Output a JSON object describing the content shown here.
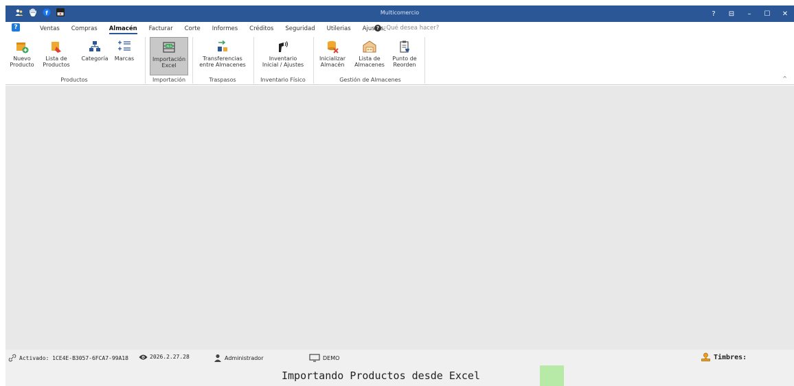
{
  "window": {
    "title": "Multicomercio",
    "controls": [
      "?",
      "⊟",
      "–",
      "☐",
      "✕"
    ],
    "quick_access_icons": [
      "users-icon",
      "hand-icon",
      "facebook-icon",
      "youtube-icon"
    ]
  },
  "menu": {
    "help_label": "?",
    "tabs": [
      "Ventas",
      "Compras",
      "Almacén",
      "Facturar",
      "Corte",
      "Informes",
      "Créditos",
      "Seguridad",
      "Utilerias",
      "Ajustes"
    ],
    "active_tab": "Almacén",
    "search_placeholder": "¿Qué desea hacer?"
  },
  "ribbon": {
    "groups": {
      "productos": "Productos",
      "importacion": "Importación",
      "traspasos": "Traspasos",
      "inventario": "Inventario Físico",
      "gestion": "Gestión de Almacenes"
    },
    "buttons": {
      "nuevo_producto": "Nuevo\nProducto",
      "lista_productos": "Lista de\nProductos",
      "categoria": "Categoría",
      "marcas": "Marcas",
      "importacion_excel": "Importación\nExcel",
      "transferencias": "Transferencias\nentre Almacenes",
      "inventario_inicial": "Inventario\nInicial / Ajustes",
      "inicializar_almacen": "Inicializar\nAlmacén",
      "lista_almacenes": "Lista de\nAlmacenes",
      "punto_reorden": "Punto de\nReorden"
    },
    "colors": {
      "accent": "#2b5797",
      "icon_orange": "#f0a830",
      "icon_blue": "#2b5797",
      "icon_red": "#e04030"
    }
  },
  "status": {
    "activation": "Activado: 1CE4E-B3057-6FCA7-99A18",
    "version": "2026.2.27.28",
    "user": "Administrador",
    "mode": "DEMO",
    "timbres": "Timbres:"
  },
  "progress": {
    "message": "Importando Productos desde Excel",
    "bar_color": "#b7e9a7"
  }
}
